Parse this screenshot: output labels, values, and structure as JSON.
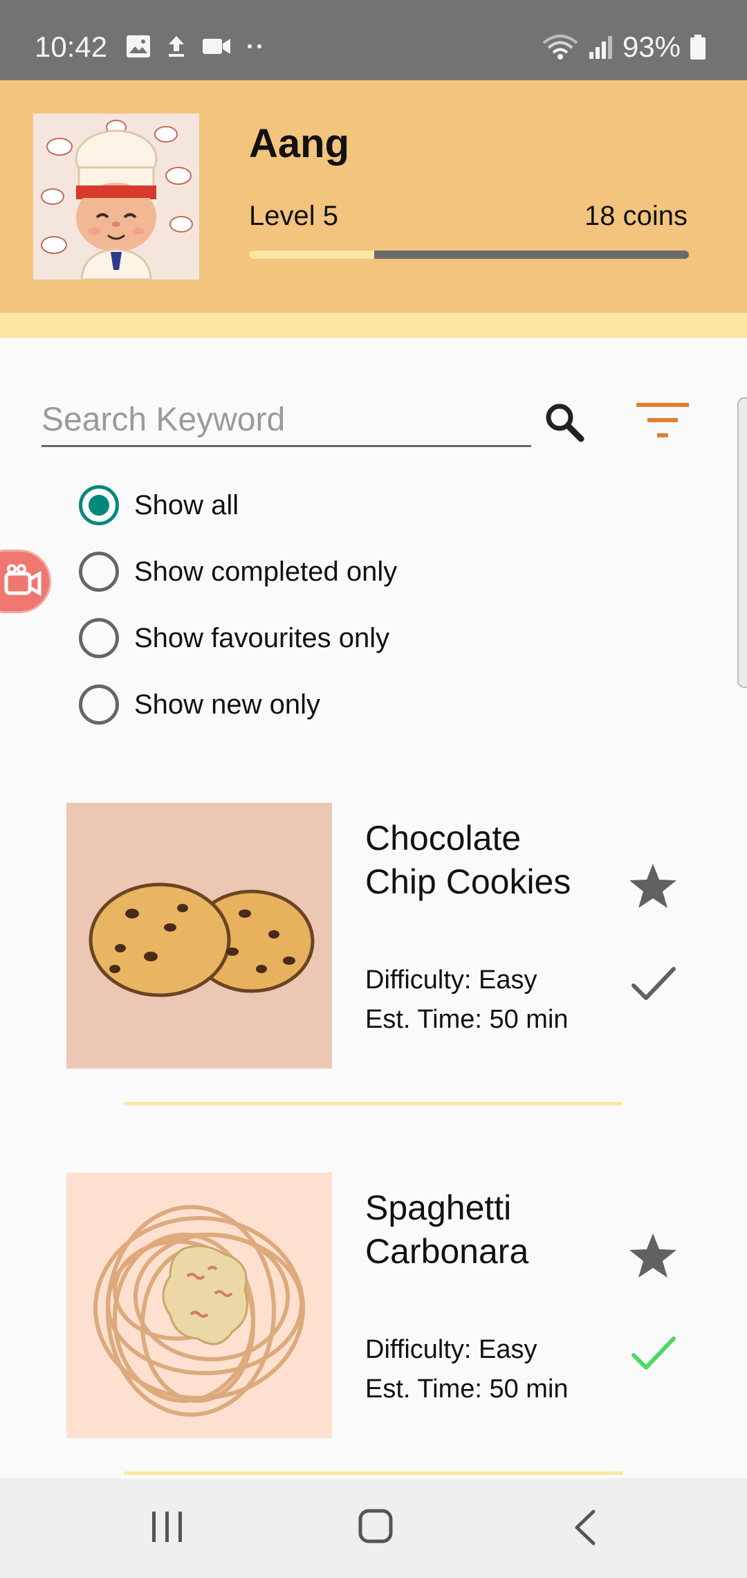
{
  "status_bar": {
    "time": "10:42",
    "battery": "93%"
  },
  "header": {
    "username": "Aang",
    "level": "Level 5",
    "coins": "18 coins",
    "xp_progress": 0.285,
    "colors": {
      "header_bg": "#f3c47e",
      "strip": "#fce6a2",
      "bar_track": "#6b6b6b"
    }
  },
  "search": {
    "placeholder": "Search Keyword",
    "value": ""
  },
  "filters": {
    "options": [
      {
        "label": "Show all",
        "selected": true
      },
      {
        "label": "Show completed only",
        "selected": false
      },
      {
        "label": "Show favourites only",
        "selected": false
      },
      {
        "label": "Show new only",
        "selected": false
      }
    ],
    "accent": "#00897b"
  },
  "recipes": [
    {
      "title_line1": "Chocolate",
      "title_line2": "Chip Cookies",
      "difficulty": "Difficulty: Easy",
      "time": "Est. Time: 50 min",
      "favourite": true,
      "completed": false,
      "image_icon": "cookies-image",
      "image_bg": "#ecc8b4"
    },
    {
      "title_line1": "Spaghetti",
      "title_line2": "Carbonara",
      "difficulty": "Difficulty: Easy",
      "time": "Est. Time: 50 min",
      "favourite": true,
      "completed": true,
      "image_icon": "spaghetti-image",
      "image_bg": "#fde0d0"
    }
  ],
  "icons": {
    "search": "search-icon",
    "filter": "filter-icon",
    "star": "star-icon",
    "check": "check-icon"
  }
}
